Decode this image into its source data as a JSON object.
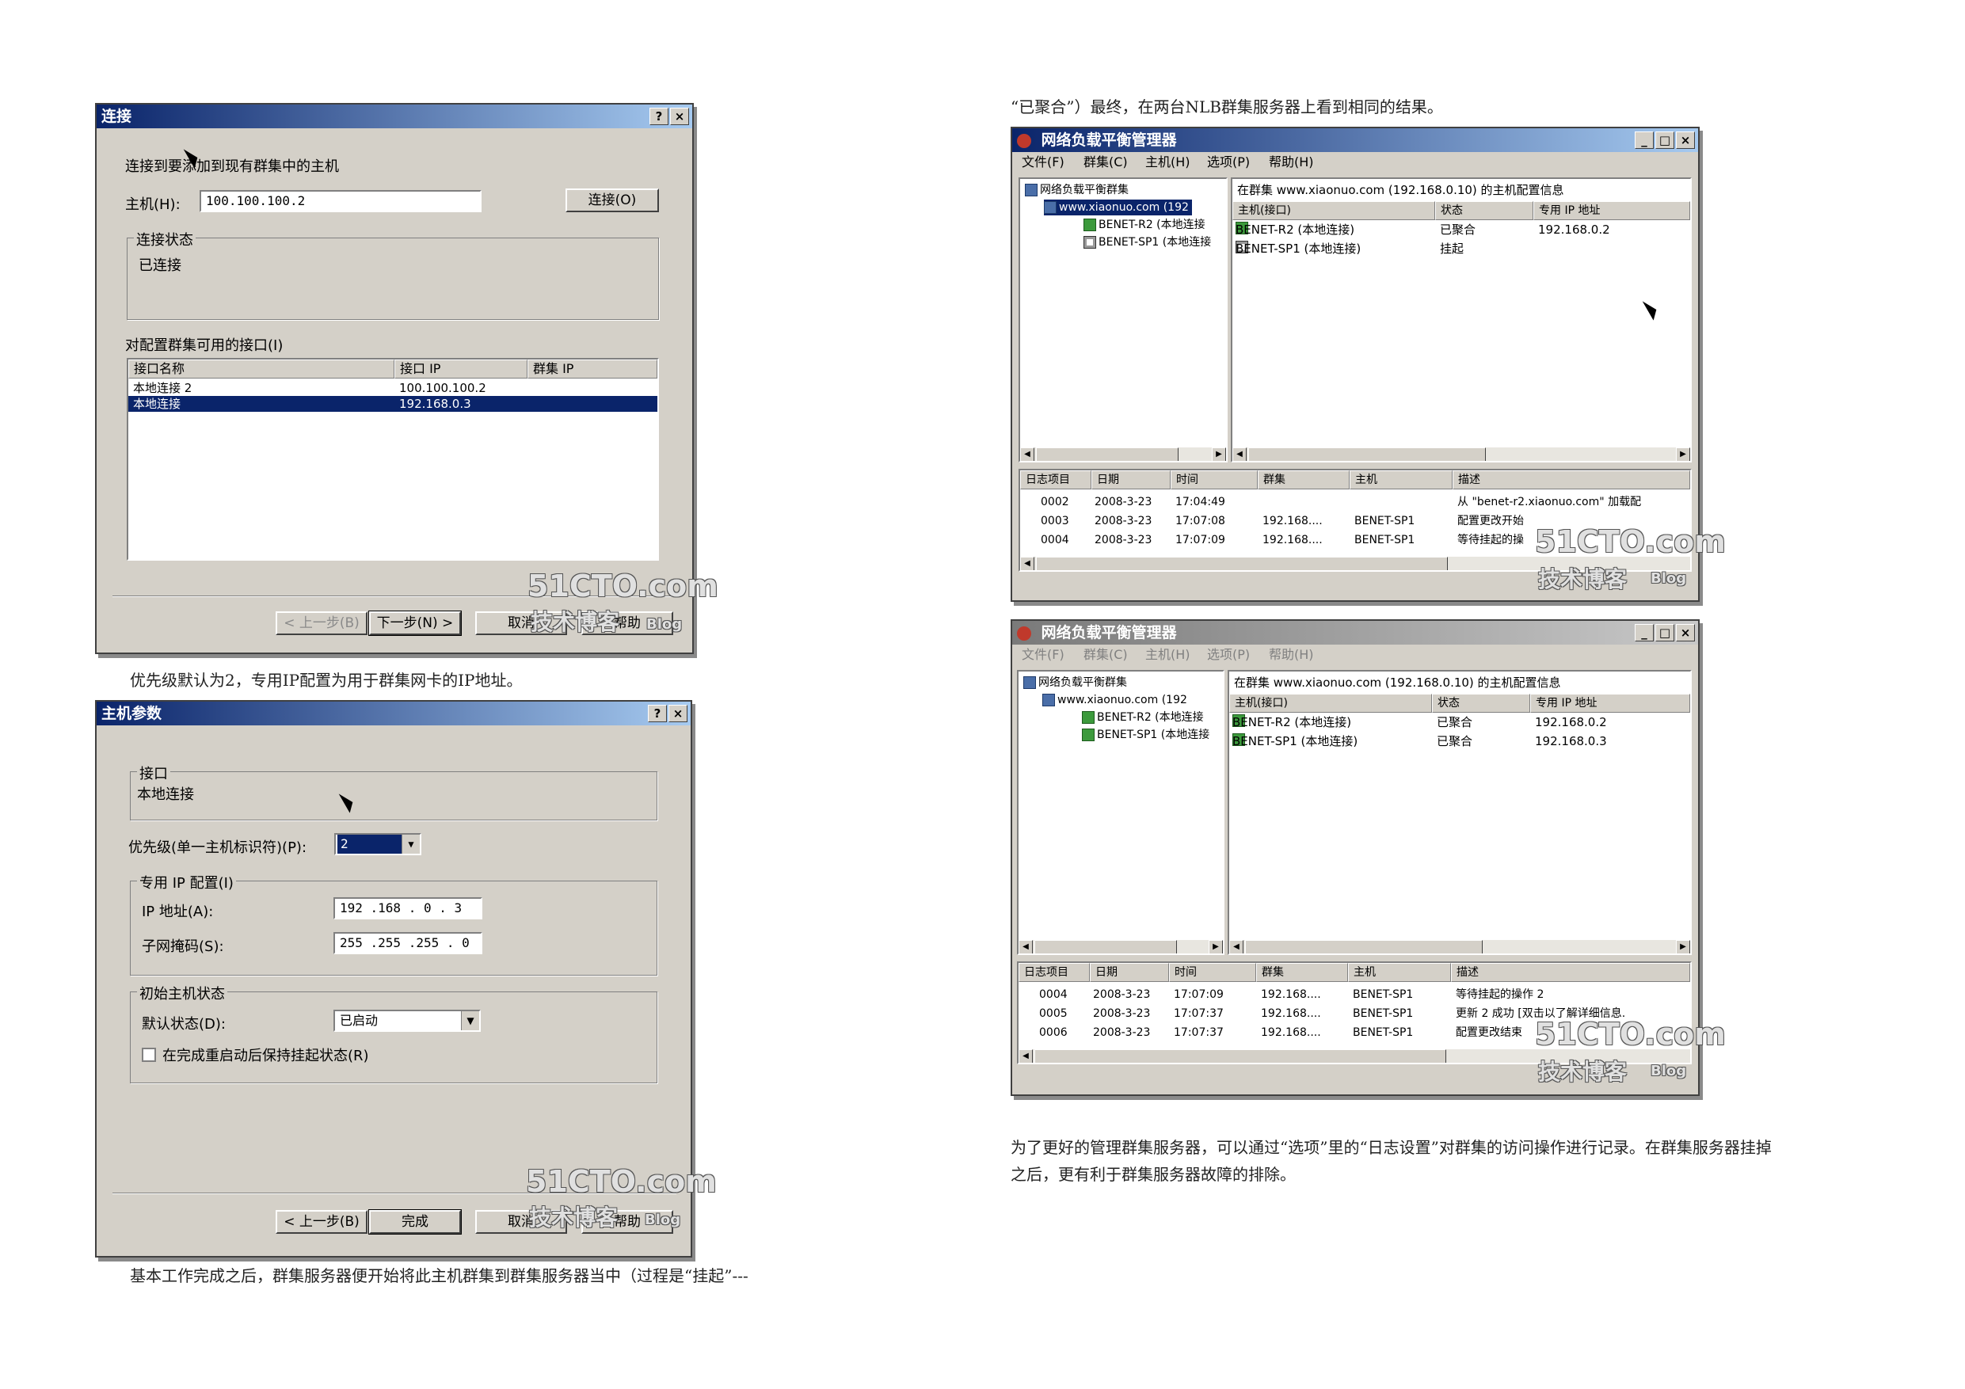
{
  "captions": {
    "c1": "优先级默认为2，专用IP配置为用于群集网卡的IP地址。",
    "c2": "基本工作完成之后，群集服务器便开始将此主机群集到群集服务器当中（过程是“挂起”---",
    "c3": "“已聚合”）最终，在两台NLB群集服务器上看到相同的结果。",
    "c4_line1": "为了更好的管理群集服务器，可以通过“选项”里的“日志设置”对群集的访问操作进行记录。在群集服务器挂掉",
    "c4_line2": "之后，更有利于群集服务器故障的排除。"
  },
  "title_buttons": {
    "help": "?",
    "close": "×",
    "minimize": "_",
    "maximize": "□"
  },
  "watermark": {
    "main": "51CTO.com",
    "sub": "技术博客",
    "blog": "Blog"
  },
  "connect_dialog": {
    "title": "连接",
    "intro": "连接到要添加到现有群集中的主机",
    "host_label": "主机(H):",
    "host_value": "100.100.100.2",
    "connect_button": "连接(O)",
    "status_group": "连接状态",
    "status_value": "已连接",
    "iface_label": "对配置群集可用的接口(I)",
    "columns": [
      "接口名称",
      "接口 IP",
      "群集 IP"
    ],
    "rows": [
      {
        "name": "本地连接 2",
        "ip": "100.100.100.2",
        "cluster_ip": ""
      },
      {
        "name": "本地连接",
        "ip": "192.168.0.3",
        "cluster_ip": ""
      }
    ],
    "back_button": "< 上一步(B)",
    "next_button": "下一步(N) >",
    "cancel_button": "取消",
    "help_button": "帮助"
  },
  "host_params_dialog": {
    "title": "主机参数",
    "iface_group": "接口",
    "iface_value": "本地连接",
    "priority_label": "优先级(单一主机标识符)(P):",
    "priority_value": "2",
    "dedicated_group": "专用 IP 配置(I)",
    "ip_label": "IP 地址(A):",
    "ip_value": "192 .168 . 0  . 3",
    "mask_label": "子网掩码(S):",
    "mask_value": "255 .255 .255 . 0",
    "initial_group": "初始主机状态",
    "default_state_label": "默认状态(D):",
    "default_state_value": "已启动",
    "keep_suspended": "在完成重启动后保持挂起状态(R)",
    "back_button": "< 上一步(B)",
    "finish_button": "完成",
    "cancel_button": "取消",
    "help_button": "帮助"
  },
  "nlb_top": {
    "title": "网络负载平衡管理器",
    "menu": [
      "文件(F)",
      "群集(C)",
      "主机(H)",
      "选项(P)",
      "帮助(H)"
    ],
    "tree": {
      "root": "网络负载平衡群集",
      "cluster": "www.xiaonuo.com (192",
      "hosts": [
        "BENET-R2 (本地连接",
        "BENET-SP1 (本地连接"
      ]
    },
    "detail_title": "在群集 www.xiaonuo.com (192.168.0.10) 的主机配置信息",
    "detail_columns": [
      "主机(接口)",
      "状态",
      "专用 IP 地址"
    ],
    "detail_rows": [
      {
        "host": "BENET-R2 (本地连接)",
        "state": "已聚合",
        "ip": "192.168.0.2"
      },
      {
        "host": "BENET-SP1 (本地连接)",
        "state": "挂起",
        "ip": ""
      }
    ],
    "log_columns": [
      "日志项目",
      "日期",
      "时间",
      "群集",
      "主机",
      "描述"
    ],
    "log_rows": [
      {
        "id": "0002",
        "date": "2008-3-23",
        "time": "17:04:49",
        "cluster": "",
        "host": "",
        "desc": "从 \"benet-r2.xiaonuo.com\" 加载配"
      },
      {
        "id": "0003",
        "date": "2008-3-23",
        "time": "17:07:08",
        "cluster": "192.168....",
        "host": "BENET-SP1",
        "desc": "配置更改开始"
      },
      {
        "id": "0004",
        "date": "2008-3-23",
        "time": "17:07:09",
        "cluster": "192.168....",
        "host": "BENET-SP1",
        "desc": "等待挂起的操"
      }
    ]
  },
  "nlb_bottom": {
    "title": "网络负载平衡管理器",
    "menu": [
      "文件(F)",
      "群集(C)",
      "主机(H)",
      "选项(P)",
      "帮助(H)"
    ],
    "tree": {
      "root": "网络负载平衡群集",
      "cluster": "www.xiaonuo.com (192",
      "hosts": [
        "BENET-R2 (本地连接",
        "BENET-SP1 (本地连接"
      ]
    },
    "detail_title": "在群集 www.xiaonuo.com (192.168.0.10) 的主机配置信息",
    "detail_columns": [
      "主机(接口)",
      "状态",
      "专用 IP 地址"
    ],
    "detail_rows": [
      {
        "host": "BENET-R2 (本地连接)",
        "state": "已聚合",
        "ip": "192.168.0.2"
      },
      {
        "host": "BENET-SP1 (本地连接)",
        "state": "已聚合",
        "ip": "192.168.0.3"
      }
    ],
    "log_columns": [
      "日志项目",
      "日期",
      "时间",
      "群集",
      "主机",
      "描述"
    ],
    "log_rows": [
      {
        "id": "0004",
        "date": "2008-3-23",
        "time": "17:07:09",
        "cluster": "192.168....",
        "host": "BENET-SP1",
        "desc": "等待挂起的操作 2"
      },
      {
        "id": "0005",
        "date": "2008-3-23",
        "time": "17:07:37",
        "cluster": "192.168....",
        "host": "BENET-SP1",
        "desc": "更新 2 成功 [双击以了解详细信息."
      },
      {
        "id": "0006",
        "date": "2008-3-23",
        "time": "17:07:37",
        "cluster": "192.168....",
        "host": "BENET-SP1",
        "desc": "配置更改结束"
      }
    ]
  }
}
